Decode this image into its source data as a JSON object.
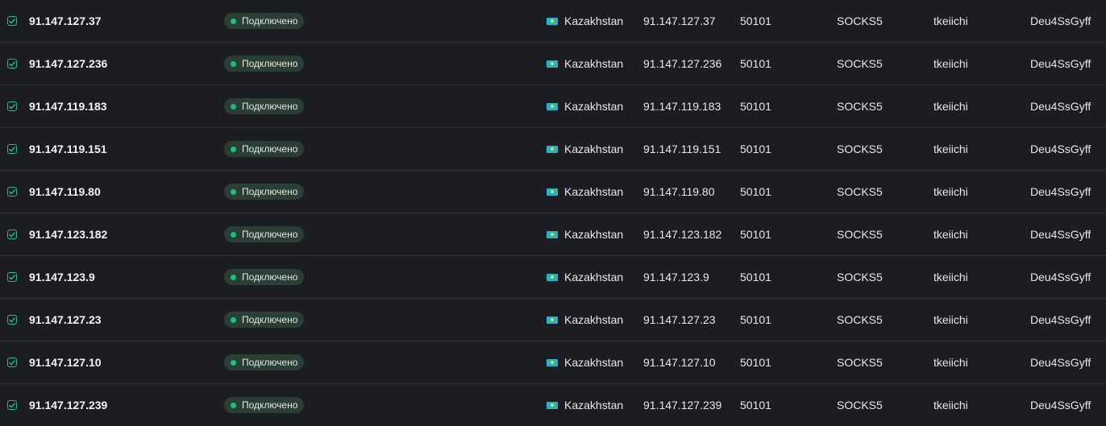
{
  "columns": {
    "status_dot_color": "#19c07c",
    "accent": "#19c07c"
  },
  "rows": [
    {
      "checked": true,
      "ip": "91.147.127.37",
      "status": "Подключено",
      "country": "Kazakhstan",
      "flag_icon": "kazakhstan-flag",
      "proxy_ip": "91.147.127.37",
      "port": "50101",
      "protocol": "SOCKS5",
      "username": "tkeiichi",
      "password": "Deu4SsGyff"
    },
    {
      "checked": true,
      "ip": "91.147.127.236",
      "status": "Подключено",
      "country": "Kazakhstan",
      "flag_icon": "kazakhstan-flag",
      "proxy_ip": "91.147.127.236",
      "port": "50101",
      "protocol": "SOCKS5",
      "username": "tkeiichi",
      "password": "Deu4SsGyff"
    },
    {
      "checked": true,
      "ip": "91.147.119.183",
      "status": "Подключено",
      "country": "Kazakhstan",
      "flag_icon": "kazakhstan-flag",
      "proxy_ip": "91.147.119.183",
      "port": "50101",
      "protocol": "SOCKS5",
      "username": "tkeiichi",
      "password": "Deu4SsGyff"
    },
    {
      "checked": true,
      "ip": "91.147.119.151",
      "status": "Подключено",
      "country": "Kazakhstan",
      "flag_icon": "kazakhstan-flag",
      "proxy_ip": "91.147.119.151",
      "port": "50101",
      "protocol": "SOCKS5",
      "username": "tkeiichi",
      "password": "Deu4SsGyff"
    },
    {
      "checked": true,
      "ip": "91.147.119.80",
      "status": "Подключено",
      "country": "Kazakhstan",
      "flag_icon": "kazakhstan-flag",
      "proxy_ip": "91.147.119.80",
      "port": "50101",
      "protocol": "SOCKS5",
      "username": "tkeiichi",
      "password": "Deu4SsGyff"
    },
    {
      "checked": true,
      "ip": "91.147.123.182",
      "status": "Подключено",
      "country": "Kazakhstan",
      "flag_icon": "kazakhstan-flag",
      "proxy_ip": "91.147.123.182",
      "port": "50101",
      "protocol": "SOCKS5",
      "username": "tkeiichi",
      "password": "Deu4SsGyff"
    },
    {
      "checked": true,
      "ip": "91.147.123.9",
      "status": "Подключено",
      "country": "Kazakhstan",
      "flag_icon": "kazakhstan-flag",
      "proxy_ip": "91.147.123.9",
      "port": "50101",
      "protocol": "SOCKS5",
      "username": "tkeiichi",
      "password": "Deu4SsGyff"
    },
    {
      "checked": true,
      "ip": "91.147.127.23",
      "status": "Подключено",
      "country": "Kazakhstan",
      "flag_icon": "kazakhstan-flag",
      "proxy_ip": "91.147.127.23",
      "port": "50101",
      "protocol": "SOCKS5",
      "username": "tkeiichi",
      "password": "Deu4SsGyff"
    },
    {
      "checked": true,
      "ip": "91.147.127.10",
      "status": "Подключено",
      "country": "Kazakhstan",
      "flag_icon": "kazakhstan-flag",
      "proxy_ip": "91.147.127.10",
      "port": "50101",
      "protocol": "SOCKS5",
      "username": "tkeiichi",
      "password": "Deu4SsGyff"
    },
    {
      "checked": true,
      "ip": "91.147.127.239",
      "status": "Подключено",
      "country": "Kazakhstan",
      "flag_icon": "kazakhstan-flag",
      "proxy_ip": "91.147.127.239",
      "port": "50101",
      "protocol": "SOCKS5",
      "username": "tkeiichi",
      "password": "Deu4SsGyff"
    }
  ]
}
